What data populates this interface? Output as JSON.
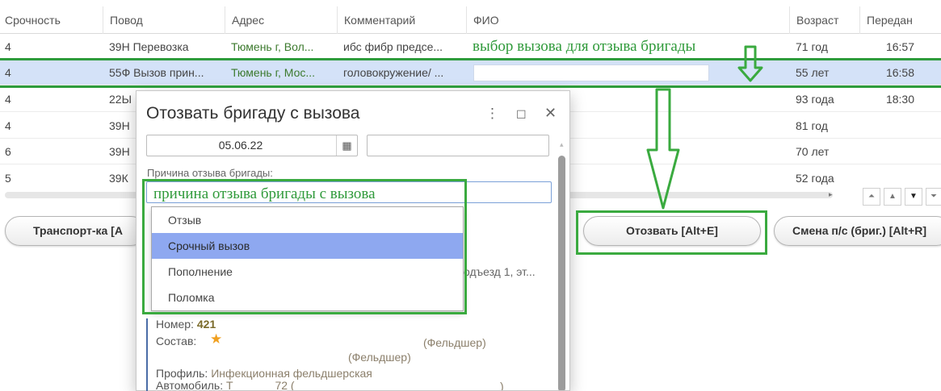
{
  "grid": {
    "columns": [
      "Срочность",
      "Повод",
      "Адрес",
      "Комментарий",
      "ФИО",
      "Возраст",
      "Передан"
    ],
    "rows": [
      {
        "urgency": "4",
        "reason": "39Н Перевозка",
        "address": "Тюмень г, Вол...",
        "comment": "ибс фибр предсе...",
        "age": "71 год",
        "time": "16:57"
      },
      {
        "urgency": "4",
        "reason": "55Ф Вызов прин...",
        "address": "Тюмень г, Мос...",
        "comment": "головокружение/ ...",
        "age": "55 лет",
        "time": "16:58"
      },
      {
        "urgency": "4",
        "reason": "22Ы",
        "address": "",
        "comment": "",
        "age": "93 года",
        "time": "18:30"
      },
      {
        "urgency": "4",
        "reason": "39Н",
        "address": "",
        "comment": "",
        "age": "81 год",
        "time": ""
      },
      {
        "urgency": "6",
        "reason": "39Н",
        "address": "",
        "comment": "",
        "age": "70 лет",
        "time": ""
      },
      {
        "urgency": "5",
        "reason": "39К",
        "address": "",
        "comment": "",
        "age": "52 года",
        "time": ""
      }
    ],
    "selected_row": 1
  },
  "annotations": {
    "call_select": "выбор вызова для отзыва бригады",
    "reason_hint": "причина отзыва бригады с вызова"
  },
  "toolbar": {
    "transport": "Транспорт-ка [A",
    "recall": "Отозвать [Alt+E]",
    "change_crew": "Смена п/с (бриг.) [Alt+R]"
  },
  "dialog": {
    "title": "Отозвать бригаду с вызова",
    "date": "05.06.22",
    "reason_label": "Причина отзыва бригады:",
    "address_fragment": "одъезд 1, эт...",
    "number_label": "Номер:",
    "number_value": "421",
    "crew_label": "Состав:",
    "crew_role1": "(Фельдшер)",
    "crew_role2": "(Фельдшер)",
    "profile_label": "Профиль:",
    "profile_value": "Инфекционная фельдшерская",
    "vehicle_label": "Автомобиль:",
    "vehicle_value": "Т",
    "vehicle_value2": "72 (",
    "vehicle_close": ")"
  },
  "dropdown": {
    "options": [
      "Отзыв",
      "Срочный вызов",
      "Пополнение",
      "Поломка"
    ],
    "selected": "Срочный вызов"
  },
  "colors": {
    "annotation": "#2e9c3c",
    "selected_row": "#d4e2f8",
    "dropdown_selected": "#8ea8f0",
    "address_text": "#3c7a2e"
  }
}
